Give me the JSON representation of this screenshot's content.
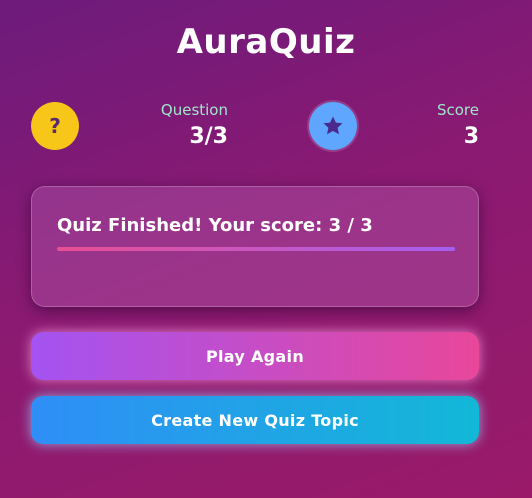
{
  "app": {
    "title": "AuraQuiz"
  },
  "stats": {
    "question": {
      "icon": "question-icon",
      "glyph": "?",
      "label": "Question",
      "value": "3/3"
    },
    "score": {
      "icon": "star-icon",
      "label": "Score",
      "value": "3"
    }
  },
  "result": {
    "message": "Quiz Finished! Your score: 3 / 3",
    "progress": 1.0
  },
  "actions": {
    "play_again_label": "Play Again",
    "create_topic_label": "Create New Quiz Topic"
  },
  "colors": {
    "question_icon_bg": "#f6c718",
    "star_icon_bg": "#5ea6ff",
    "label_green": "#9fe6c9"
  }
}
